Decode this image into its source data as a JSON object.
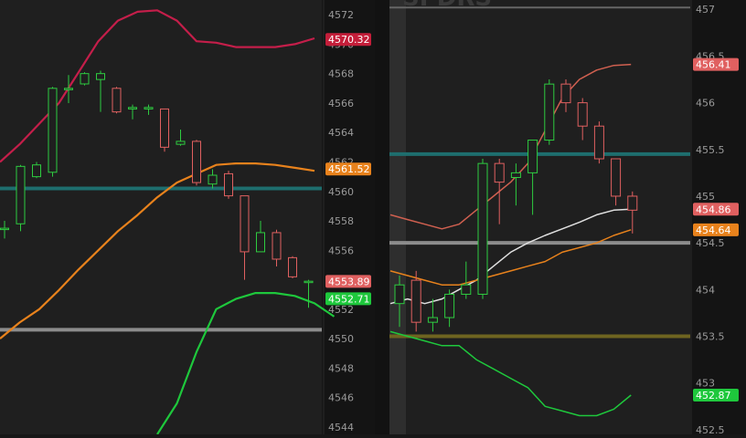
{
  "chart_data": [
    {
      "type": "candlestick",
      "ylim": [
        4543.5,
        4573
      ],
      "y_ticks": [
        "4572",
        "4570",
        "4568",
        "4566",
        "4564",
        "4562",
        "4560",
        "4558",
        "4556",
        "4554",
        "4552",
        "4550",
        "4548",
        "4546",
        "4544"
      ],
      "candles": [
        {
          "o": 4557.5,
          "h": 4558.0,
          "l": 4556.8,
          "c": 4557.5
        },
        {
          "o": 4557.8,
          "h": 4561.8,
          "l": 4557.3,
          "c": 4561.7
        },
        {
          "o": 4561.0,
          "h": 4562.0,
          "l": 4560.9,
          "c": 4561.8
        },
        {
          "o": 4561.3,
          "h": 4567.1,
          "l": 4561.0,
          "c": 4567.0
        },
        {
          "o": 4567.0,
          "h": 4567.9,
          "l": 4566.0,
          "c": 4567.0
        },
        {
          "o": 4567.3,
          "h": 4568.1,
          "l": 4567.2,
          "c": 4568.0
        },
        {
          "o": 4567.6,
          "h": 4568.2,
          "l": 4565.4,
          "c": 4568.0
        },
        {
          "o": 4567.0,
          "h": 4567.1,
          "l": 4565.3,
          "c": 4565.4
        },
        {
          "o": 4565.6,
          "h": 4565.9,
          "l": 4564.9,
          "c": 4565.7
        },
        {
          "o": 4565.6,
          "h": 4565.9,
          "l": 4565.2,
          "c": 4565.7
        },
        {
          "o": 4565.6,
          "h": 4565.6,
          "l": 4562.7,
          "c": 4563.0
        },
        {
          "o": 4563.2,
          "h": 4564.2,
          "l": 4563.1,
          "c": 4563.4
        },
        {
          "o": 4563.4,
          "h": 4563.5,
          "l": 4560.4,
          "c": 4560.6
        },
        {
          "o": 4560.5,
          "h": 4561.5,
          "l": 4560.2,
          "c": 4561.1
        },
        {
          "o": 4561.2,
          "h": 4561.4,
          "l": 4559.5,
          "c": 4559.7
        },
        {
          "o": 4559.7,
          "h": 4559.7,
          "l": 4554.0,
          "c": 4555.9
        },
        {
          "o": 4555.9,
          "h": 4558.0,
          "l": 4555.9,
          "c": 4557.2
        },
        {
          "o": 4557.2,
          "h": 4557.4,
          "l": 4554.9,
          "c": 4555.4
        },
        {
          "o": 4555.5,
          "h": 4555.6,
          "l": 4554.1,
          "c": 4554.2
        },
        {
          "o": 4553.9,
          "h": 4554.0,
          "l": 4552.1,
          "c": 4553.9
        }
      ],
      "lines": [
        {
          "color": "#c41e4a",
          "points": [
            [
              0,
              4562.0
            ],
            [
              1,
              4563.2
            ],
            [
              2,
              4564.6
            ],
            [
              3,
              4566.0
            ],
            [
              4,
              4568.1
            ],
            [
              5,
              4570.2
            ],
            [
              6,
              4571.6
            ],
            [
              7,
              4572.2
            ],
            [
              8,
              4572.3
            ],
            [
              9,
              4571.6
            ],
            [
              10,
              4570.2
            ],
            [
              11,
              4570.1
            ],
            [
              12,
              4569.8
            ],
            [
              13,
              4569.8
            ],
            [
              14,
              4569.8
            ],
            [
              15,
              4570.0
            ],
            [
              16,
              4570.4
            ]
          ]
        },
        {
          "color": "#e8821c",
          "points": [
            [
              0,
              4550.0
            ],
            [
              1,
              4551.1
            ],
            [
              2,
              4552.0
            ],
            [
              3,
              4553.3
            ],
            [
              4,
              4554.7
            ],
            [
              5,
              4556.0
            ],
            [
              6,
              4557.3
            ],
            [
              7,
              4558.4
            ],
            [
              8,
              4559.6
            ],
            [
              9,
              4560.6
            ],
            [
              10,
              4561.2
            ],
            [
              11,
              4561.8
            ],
            [
              12,
              4561.9
            ],
            [
              13,
              4561.9
            ],
            [
              14,
              4561.8
            ],
            [
              15,
              4561.6
            ],
            [
              16,
              4561.4
            ]
          ]
        },
        {
          "color": "#1ec83c",
          "points": [
            [
              8,
              4543.5
            ],
            [
              9,
              4545.6
            ],
            [
              10,
              4549.1
            ],
            [
              11,
              4552.0
            ],
            [
              12,
              4552.7
            ],
            [
              13,
              4553.1
            ],
            [
              14,
              4553.1
            ],
            [
              15,
              4552.9
            ],
            [
              16,
              4552.4
            ],
            [
              17,
              4551.5
            ]
          ]
        }
      ],
      "h_lines": [
        {
          "value": 4560.2,
          "color": "#1e6e6e"
        },
        {
          "value": 4550.6,
          "color": "#8c8c8c"
        }
      ],
      "badges": [
        {
          "text": "4570.32",
          "value": 4570.32,
          "bg": "#c41e3a"
        },
        {
          "text": "4561.52",
          "value": 4561.52,
          "bg": "#e8821c"
        },
        {
          "text": "4553.89",
          "value": 4553.89,
          "bg": "#e06060"
        },
        {
          "text": "4552.71",
          "value": 4552.71,
          "bg": "#1ec83c"
        }
      ]
    },
    {
      "type": "candlestick",
      "watermark": "SPDRS",
      "ylim": [
        452.45,
        457.1
      ],
      "y_ticks": [
        "457",
        "456.5",
        "456",
        "455.5",
        "455",
        "454.5",
        "454",
        "453.5",
        "453",
        "452.5"
      ],
      "candles": [
        {
          "o": 453.85,
          "h": 454.15,
          "l": 453.6,
          "c": 454.05
        },
        {
          "o": 454.1,
          "h": 454.2,
          "l": 453.55,
          "c": 453.65
        },
        {
          "o": 453.65,
          "h": 453.9,
          "l": 453.55,
          "c": 453.7
        },
        {
          "o": 453.7,
          "h": 454.0,
          "l": 453.6,
          "c": 453.95
        },
        {
          "o": 453.95,
          "h": 454.3,
          "l": 453.9,
          "c": 454.05
        },
        {
          "o": 453.95,
          "h": 455.4,
          "l": 453.9,
          "c": 455.35
        },
        {
          "o": 455.35,
          "h": 455.4,
          "l": 454.7,
          "c": 455.15
        },
        {
          "o": 455.2,
          "h": 455.35,
          "l": 454.9,
          "c": 455.25
        },
        {
          "o": 455.25,
          "h": 455.6,
          "l": 454.8,
          "c": 455.6
        },
        {
          "o": 455.6,
          "h": 456.25,
          "l": 455.55,
          "c": 456.2
        },
        {
          "o": 456.2,
          "h": 456.25,
          "l": 455.9,
          "c": 456.0
        },
        {
          "o": 456.0,
          "h": 456.05,
          "l": 455.6,
          "c": 455.75
        },
        {
          "o": 455.75,
          "h": 455.8,
          "l": 455.35,
          "c": 455.4
        },
        {
          "o": 455.4,
          "h": 455.4,
          "l": 454.9,
          "c": 455.0
        },
        {
          "o": 455.0,
          "h": 455.05,
          "l": 454.6,
          "c": 454.85
        }
      ],
      "lines": [
        {
          "color": "#d06050",
          "points": [
            [
              0,
              454.8
            ],
            [
              1,
              454.75
            ],
            [
              2,
              454.7
            ],
            [
              3,
              454.65
            ],
            [
              4,
              454.7
            ],
            [
              5,
              454.85
            ],
            [
              6,
              455.0
            ],
            [
              7,
              455.15
            ],
            [
              8,
              455.35
            ],
            [
              9,
              455.7
            ],
            [
              10,
              456.05
            ],
            [
              11,
              456.25
            ],
            [
              12,
              456.35
            ],
            [
              13,
              456.4
            ],
            [
              14,
              456.41
            ]
          ]
        },
        {
          "color": "#e0e0e0",
          "points": [
            [
              0,
              453.85
            ],
            [
              1,
              453.9
            ],
            [
              2,
              453.85
            ],
            [
              3,
              453.9
            ],
            [
              4,
              454.0
            ],
            [
              5,
              454.1
            ],
            [
              6,
              454.25
            ],
            [
              7,
              454.4
            ],
            [
              8,
              454.5
            ],
            [
              9,
              454.58
            ],
            [
              10,
              454.65
            ],
            [
              11,
              454.72
            ],
            [
              12,
              454.8
            ],
            [
              13,
              454.85
            ],
            [
              14,
              454.86
            ]
          ]
        },
        {
          "color": "#e8821c",
          "points": [
            [
              0,
              454.2
            ],
            [
              1,
              454.15
            ],
            [
              2,
              454.1
            ],
            [
              3,
              454.05
            ],
            [
              4,
              454.05
            ],
            [
              5,
              454.1
            ],
            [
              6,
              454.15
            ],
            [
              7,
              454.2
            ],
            [
              8,
              454.25
            ],
            [
              9,
              454.3
            ],
            [
              10,
              454.4
            ],
            [
              11,
              454.45
            ],
            [
              12,
              454.5
            ],
            [
              13,
              454.58
            ],
            [
              14,
              454.64
            ]
          ]
        },
        {
          "color": "#1ec83c",
          "points": [
            [
              0,
              453.55
            ],
            [
              1,
              453.5
            ],
            [
              2,
              453.45
            ],
            [
              3,
              453.4
            ],
            [
              4,
              453.4
            ],
            [
              5,
              453.25
            ],
            [
              6,
              453.15
            ],
            [
              7,
              453.05
            ],
            [
              8,
              452.95
            ],
            [
              9,
              452.75
            ],
            [
              10,
              452.7
            ],
            [
              11,
              452.65
            ],
            [
              12,
              452.65
            ],
            [
              13,
              452.72
            ],
            [
              14,
              452.87
            ]
          ]
        }
      ],
      "h_lines": [
        {
          "value": 457.02,
          "color": "#666666"
        },
        {
          "value": 455.45,
          "color": "#1e6e6e"
        },
        {
          "value": 454.5,
          "color": "#8c8c8c"
        },
        {
          "value": 453.5,
          "color": "#6e6420"
        }
      ],
      "badges": [
        {
          "text": "456.41",
          "value": 456.41,
          "bg": "#e06060"
        },
        {
          "text": "454.86",
          "value": 454.86,
          "bg": "#e06060"
        },
        {
          "text": "454.64",
          "value": 454.64,
          "bg": "#e8821c"
        },
        {
          "text": "452.87",
          "value": 452.87,
          "bg": "#1ec83c"
        }
      ]
    }
  ]
}
